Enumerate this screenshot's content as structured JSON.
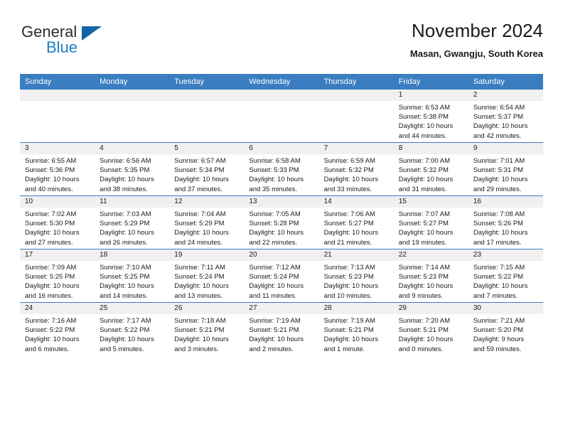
{
  "brand": {
    "name_part1": "General",
    "name_part2": "Blue"
  },
  "header": {
    "title": "November 2024",
    "location": "Masan, Gwangju, South Korea"
  },
  "colors": {
    "header_blue": "#3a7dc0",
    "logo_blue": "#1c7cc4",
    "daynum_band": "#f0f0f0"
  },
  "weekday_headers": [
    "Sunday",
    "Monday",
    "Tuesday",
    "Wednesday",
    "Thursday",
    "Friday",
    "Saturday"
  ],
  "weeks": [
    [
      {
        "empty": true
      },
      {
        "empty": true
      },
      {
        "empty": true
      },
      {
        "empty": true
      },
      {
        "empty": true
      },
      {
        "day": "1",
        "sunrise": "Sunrise: 6:53 AM",
        "sunset": "Sunset: 5:38 PM",
        "daylight1": "Daylight: 10 hours",
        "daylight2": "and 44 minutes."
      },
      {
        "day": "2",
        "sunrise": "Sunrise: 6:54 AM",
        "sunset": "Sunset: 5:37 PM",
        "daylight1": "Daylight: 10 hours",
        "daylight2": "and 42 minutes."
      }
    ],
    [
      {
        "day": "3",
        "sunrise": "Sunrise: 6:55 AM",
        "sunset": "Sunset: 5:36 PM",
        "daylight1": "Daylight: 10 hours",
        "daylight2": "and 40 minutes."
      },
      {
        "day": "4",
        "sunrise": "Sunrise: 6:56 AM",
        "sunset": "Sunset: 5:35 PM",
        "daylight1": "Daylight: 10 hours",
        "daylight2": "and 38 minutes."
      },
      {
        "day": "5",
        "sunrise": "Sunrise: 6:57 AM",
        "sunset": "Sunset: 5:34 PM",
        "daylight1": "Daylight: 10 hours",
        "daylight2": "and 37 minutes."
      },
      {
        "day": "6",
        "sunrise": "Sunrise: 6:58 AM",
        "sunset": "Sunset: 5:33 PM",
        "daylight1": "Daylight: 10 hours",
        "daylight2": "and 35 minutes."
      },
      {
        "day": "7",
        "sunrise": "Sunrise: 6:59 AM",
        "sunset": "Sunset: 5:32 PM",
        "daylight1": "Daylight: 10 hours",
        "daylight2": "and 33 minutes."
      },
      {
        "day": "8",
        "sunrise": "Sunrise: 7:00 AM",
        "sunset": "Sunset: 5:32 PM",
        "daylight1": "Daylight: 10 hours",
        "daylight2": "and 31 minutes."
      },
      {
        "day": "9",
        "sunrise": "Sunrise: 7:01 AM",
        "sunset": "Sunset: 5:31 PM",
        "daylight1": "Daylight: 10 hours",
        "daylight2": "and 29 minutes."
      }
    ],
    [
      {
        "day": "10",
        "sunrise": "Sunrise: 7:02 AM",
        "sunset": "Sunset: 5:30 PM",
        "daylight1": "Daylight: 10 hours",
        "daylight2": "and 27 minutes."
      },
      {
        "day": "11",
        "sunrise": "Sunrise: 7:03 AM",
        "sunset": "Sunset: 5:29 PM",
        "daylight1": "Daylight: 10 hours",
        "daylight2": "and 26 minutes."
      },
      {
        "day": "12",
        "sunrise": "Sunrise: 7:04 AM",
        "sunset": "Sunset: 5:29 PM",
        "daylight1": "Daylight: 10 hours",
        "daylight2": "and 24 minutes."
      },
      {
        "day": "13",
        "sunrise": "Sunrise: 7:05 AM",
        "sunset": "Sunset: 5:28 PM",
        "daylight1": "Daylight: 10 hours",
        "daylight2": "and 22 minutes."
      },
      {
        "day": "14",
        "sunrise": "Sunrise: 7:06 AM",
        "sunset": "Sunset: 5:27 PM",
        "daylight1": "Daylight: 10 hours",
        "daylight2": "and 21 minutes."
      },
      {
        "day": "15",
        "sunrise": "Sunrise: 7:07 AM",
        "sunset": "Sunset: 5:27 PM",
        "daylight1": "Daylight: 10 hours",
        "daylight2": "and 19 minutes."
      },
      {
        "day": "16",
        "sunrise": "Sunrise: 7:08 AM",
        "sunset": "Sunset: 5:26 PM",
        "daylight1": "Daylight: 10 hours",
        "daylight2": "and 17 minutes."
      }
    ],
    [
      {
        "day": "17",
        "sunrise": "Sunrise: 7:09 AM",
        "sunset": "Sunset: 5:25 PM",
        "daylight1": "Daylight: 10 hours",
        "daylight2": "and 16 minutes."
      },
      {
        "day": "18",
        "sunrise": "Sunrise: 7:10 AM",
        "sunset": "Sunset: 5:25 PM",
        "daylight1": "Daylight: 10 hours",
        "daylight2": "and 14 minutes."
      },
      {
        "day": "19",
        "sunrise": "Sunrise: 7:11 AM",
        "sunset": "Sunset: 5:24 PM",
        "daylight1": "Daylight: 10 hours",
        "daylight2": "and 13 minutes."
      },
      {
        "day": "20",
        "sunrise": "Sunrise: 7:12 AM",
        "sunset": "Sunset: 5:24 PM",
        "daylight1": "Daylight: 10 hours",
        "daylight2": "and 11 minutes."
      },
      {
        "day": "21",
        "sunrise": "Sunrise: 7:13 AM",
        "sunset": "Sunset: 5:23 PM",
        "daylight1": "Daylight: 10 hours",
        "daylight2": "and 10 minutes."
      },
      {
        "day": "22",
        "sunrise": "Sunrise: 7:14 AM",
        "sunset": "Sunset: 5:23 PM",
        "daylight1": "Daylight: 10 hours",
        "daylight2": "and 9 minutes."
      },
      {
        "day": "23",
        "sunrise": "Sunrise: 7:15 AM",
        "sunset": "Sunset: 5:22 PM",
        "daylight1": "Daylight: 10 hours",
        "daylight2": "and 7 minutes."
      }
    ],
    [
      {
        "day": "24",
        "sunrise": "Sunrise: 7:16 AM",
        "sunset": "Sunset: 5:22 PM",
        "daylight1": "Daylight: 10 hours",
        "daylight2": "and 6 minutes."
      },
      {
        "day": "25",
        "sunrise": "Sunrise: 7:17 AM",
        "sunset": "Sunset: 5:22 PM",
        "daylight1": "Daylight: 10 hours",
        "daylight2": "and 5 minutes."
      },
      {
        "day": "26",
        "sunrise": "Sunrise: 7:18 AM",
        "sunset": "Sunset: 5:21 PM",
        "daylight1": "Daylight: 10 hours",
        "daylight2": "and 3 minutes."
      },
      {
        "day": "27",
        "sunrise": "Sunrise: 7:19 AM",
        "sunset": "Sunset: 5:21 PM",
        "daylight1": "Daylight: 10 hours",
        "daylight2": "and 2 minutes."
      },
      {
        "day": "28",
        "sunrise": "Sunrise: 7:19 AM",
        "sunset": "Sunset: 5:21 PM",
        "daylight1": "Daylight: 10 hours",
        "daylight2": "and 1 minute."
      },
      {
        "day": "29",
        "sunrise": "Sunrise: 7:20 AM",
        "sunset": "Sunset: 5:21 PM",
        "daylight1": "Daylight: 10 hours",
        "daylight2": "and 0 minutes."
      },
      {
        "day": "30",
        "sunrise": "Sunrise: 7:21 AM",
        "sunset": "Sunset: 5:20 PM",
        "daylight1": "Daylight: 9 hours",
        "daylight2": "and 59 minutes."
      }
    ]
  ]
}
